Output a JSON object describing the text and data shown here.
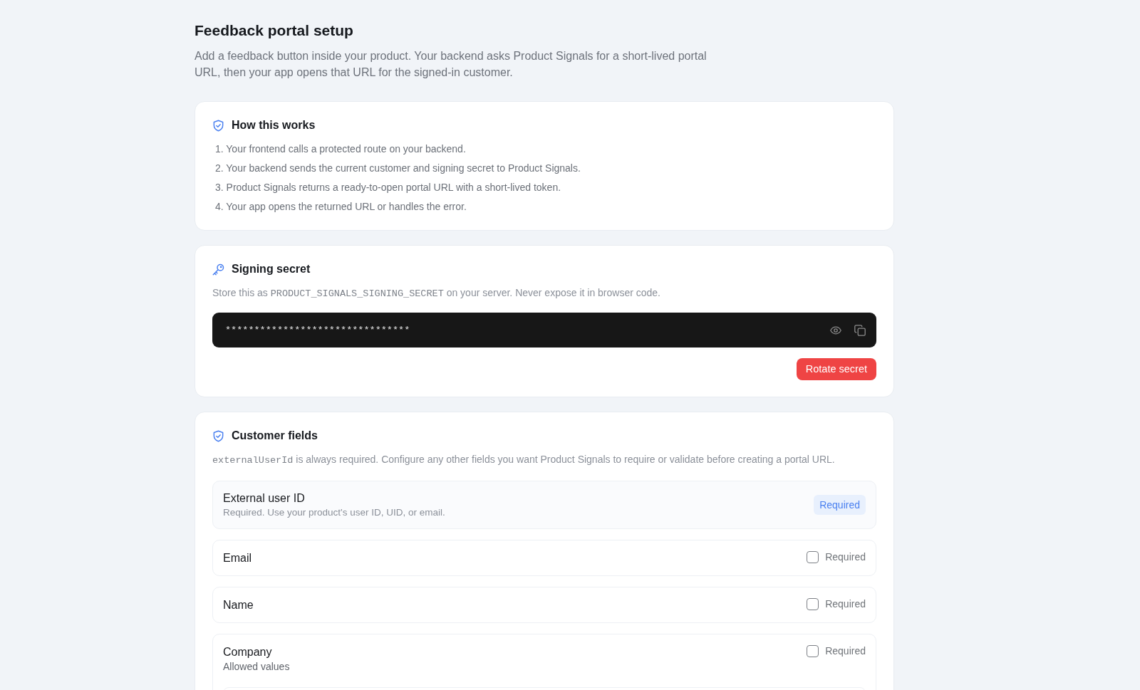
{
  "page": {
    "title": "Feedback portal setup",
    "description": "Add a feedback button inside your product. Your backend asks Product Signals for a short-lived portal URL, then your app opens that URL for the signed-in customer."
  },
  "how_this_works": {
    "title": "How this works",
    "steps": [
      "1. Your frontend calls a protected route on your backend.",
      "2. Your backend sends the current customer and signing secret to Product Signals.",
      "3. Product Signals returns a ready-to-open portal URL with a short-lived token.",
      "4. Your app opens the returned URL or handles the error."
    ]
  },
  "signing_secret": {
    "title": "Signing secret",
    "description": [
      {
        "kind": "text",
        "text": "Store this as "
      },
      {
        "kind": "code",
        "text": "PRODUCT_SIGNALS_SIGNING_SECRET"
      },
      {
        "kind": "text",
        "text": " on your server. Never expose it in browser code."
      }
    ],
    "secret_value": "********************************",
    "rotate_button": "Rotate secret"
  },
  "customer_fields": {
    "title": "Customer fields",
    "description": [
      {
        "kind": "code",
        "text": "externalUserId"
      },
      {
        "kind": "text",
        "text": " is always required. Configure any other fields you want Product Signals to require or validate before creating a portal URL."
      }
    ],
    "fields": [
      {
        "kind": "fixed",
        "label": "External user ID",
        "hint": "Required. Use your product's user ID, UID, or email.",
        "badge": "Required"
      },
      {
        "kind": "toggle",
        "label": "Email",
        "checkbox_label": "Required",
        "checked": false
      },
      {
        "kind": "toggle",
        "label": "Name",
        "checkbox_label": "Required",
        "checked": false
      },
      {
        "kind": "toggle",
        "label": "Company",
        "checkbox_label": "Required",
        "checked": false,
        "values_label": "Allowed values"
      }
    ]
  }
}
